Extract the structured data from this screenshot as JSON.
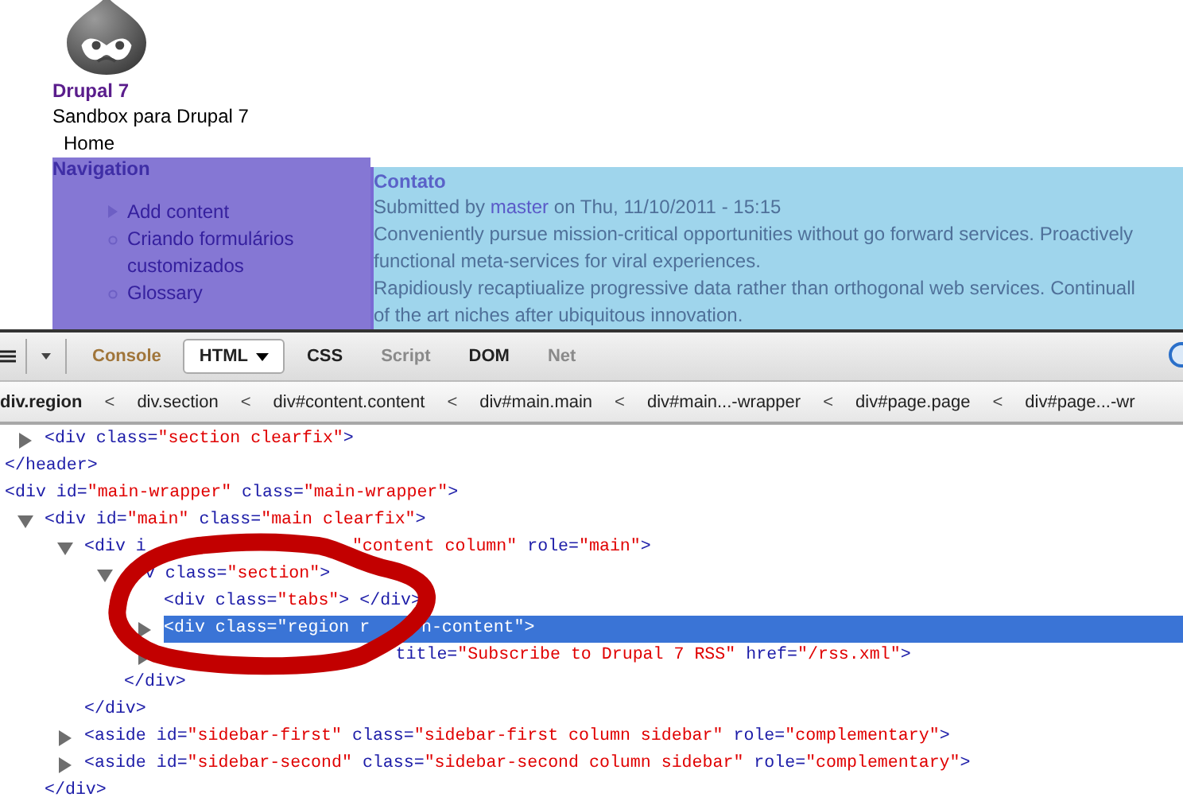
{
  "site": {
    "name": "Drupal 7",
    "slogan": "Sandbox para Drupal 7",
    "menu": [
      "Home"
    ]
  },
  "sidebar": {
    "title": "Navigation",
    "items": [
      {
        "label": "Add content",
        "expanded": false
      },
      {
        "label": "Criando formulários customizados"
      },
      {
        "label": "Glossary"
      }
    ]
  },
  "article": {
    "title": "Contato",
    "submitted": {
      "before": "Submitted by",
      "author": "master",
      "after": "on Thu, 11/10/2011 - 15:15"
    },
    "lines": [
      "Conveniently pursue mission-critical opportunities without go forward services. Proactively",
      "functional meta-services for viral experiences.",
      "Rapidiously recaptiualize progressive data rather than orthogonal web services. Continuall",
      "of the art niches after ubiquitous innovation."
    ]
  },
  "devtools": {
    "tabs": [
      {
        "label": "Console",
        "selected": false,
        "dimmed": false,
        "notice": true
      },
      {
        "label": "HTML",
        "selected": true,
        "dimmed": false,
        "notice": false
      },
      {
        "label": "CSS",
        "selected": false,
        "dimmed": false,
        "notice": false
      },
      {
        "label": "Script",
        "selected": false,
        "dimmed": true,
        "notice": false
      },
      {
        "label": "DOM",
        "selected": false,
        "dimmed": false,
        "notice": false
      },
      {
        "label": "Net",
        "selected": false,
        "dimmed": true,
        "notice": false
      }
    ],
    "breadcrumb": [
      {
        "label": "div.region",
        "selected": true
      },
      {
        "separator": "<",
        "label": "div.section",
        "selected": false
      },
      {
        "separator": "<",
        "label": "div#content.content",
        "selected": false
      },
      {
        "separator": "<",
        "label": "div#main.main",
        "selected": false
      },
      {
        "separator": "<",
        "label": "div#main...-wrapper",
        "selected": false
      },
      {
        "separator": "<",
        "label": "div#page.page",
        "selected": false
      },
      {
        "separator": "<",
        "label": "div#page...-wr",
        "selected": false
      }
    ],
    "tree": [
      {
        "children": [
          {
            "open": [
              [
                {
                  "s": "<div class=",
                  "attr": false
                },
                {
                  "s": "\"section clearfix\"",
                  "attr": true
                },
                {
                  "s": ">",
                  "attr": false
                }
              ]
            ],
            "expanded": false,
            "selected": false
          }
        ],
        "close": "</header>"
      },
      {
        "open": [
          [
            {
              "s": "<div id=",
              "attr": false
            },
            {
              "s": "\"main-wrapper\"",
              "attr": true
            },
            {
              "s": " class=",
              "attr": false
            },
            {
              "s": "\"main-wrapper\"",
              "attr": true
            },
            {
              "s": ">",
              "attr": false
            }
          ]
        ],
        "selected": false,
        "children": [
          {
            "open": [
              [
                {
                  "s": "<div id=",
                  "attr": false
                },
                {
                  "s": "\"main\"",
                  "attr": true
                },
                {
                  "s": " class=",
                  "attr": false
                },
                {
                  "s": "\"main clearfix\"",
                  "attr": true
                },
                {
                  "s": ">",
                  "attr": false
                }
              ]
            ],
            "expanded": true,
            "selected": false,
            "children": [
              {
                "open": [
                  [
                    {
                      "s": "<div i",
                      "attr": false
                    }
                  ],
                  [
                    {
                      "s": "\"content column\"",
                      "attr": true
                    },
                    {
                      "s": " role=",
                      "attr": false
                    },
                    {
                      "s": "\"main\"",
                      "attr": true
                    },
                    {
                      "s": ">",
                      "attr": false
                    }
                  ]
                ],
                "expanded": true,
                "selected": false,
                "children": [
                  {
                    "open": [
                      [
                        {
                          "s": "v class=",
                          "attr": false
                        },
                        {
                          "s": "\"section\"",
                          "attr": true
                        },
                        {
                          "s": ">",
                          "attr": false
                        }
                      ]
                    ],
                    "expanded": true,
                    "selected": false,
                    "children": [
                      {
                        "open": [
                          [
                            {
                              "s": "<div class=",
                              "attr": false
                            },
                            {
                              "s": "\"tabs\"",
                              "attr": true
                            },
                            {
                              "s": "> </div>",
                              "attr": false
                            }
                          ]
                        ],
                        "selected": false
                      },
                      {
                        "open": [
                          [
                            {
                              "s": "<div class="
                            },
                            {
                              "s": "\"region r"
                            }
                          ],
                          [
                            {
                              "s": "n-content\""
                            },
                            {
                              "s": ">"
                            }
                          ]
                        ],
                        "expanded": false,
                        "selected": true
                      },
                      {
                        "open": [
                          [
                            {
                              "s": "title=",
                              "attr": false
                            },
                            {
                              "s": "\"Subscribe to Drupal 7 RSS\"",
                              "attr": true
                            },
                            {
                              "s": " href=",
                              "attr": false
                            },
                            {
                              "s": "\"/rss.xml\"",
                              "attr": true
                            },
                            {
                              "s": ">",
                              "attr": false
                            }
                          ]
                        ],
                        "expanded": false,
                        "selected": false
                      }
                    ],
                    "close": "</div>"
                  }
                ],
                "close": "</div>"
              },
              {
                "open": [
                  [
                    {
                      "s": "<aside id=",
                      "attr": false
                    },
                    {
                      "s": "\"sidebar-first\"",
                      "attr": true
                    },
                    {
                      "s": " class=",
                      "attr": false
                    },
                    {
                      "s": "\"sidebar-first column sidebar\"",
                      "attr": true
                    },
                    {
                      "s": " role=",
                      "attr": false
                    },
                    {
                      "s": "\"complementary\"",
                      "attr": true
                    },
                    {
                      "s": ">",
                      "attr": false
                    }
                  ]
                ],
                "expanded": false,
                "selected": false
              },
              {
                "open": [
                  [
                    {
                      "s": "<aside id=",
                      "attr": false
                    },
                    {
                      "s": "\"sidebar-second\"",
                      "attr": true
                    },
                    {
                      "s": " class=",
                      "attr": false
                    },
                    {
                      "s": "\"sidebar-second column sidebar\"",
                      "attr": true
                    },
                    {
                      "s": " role=",
                      "attr": false
                    },
                    {
                      "s": "\"complementary\"",
                      "attr": true
                    },
                    {
                      "s": ">",
                      "attr": false
                    }
                  ]
                ],
                "expanded": false,
                "selected": false
              }
            ],
            "close": "</div>"
          }
        ]
      }
    ]
  }
}
